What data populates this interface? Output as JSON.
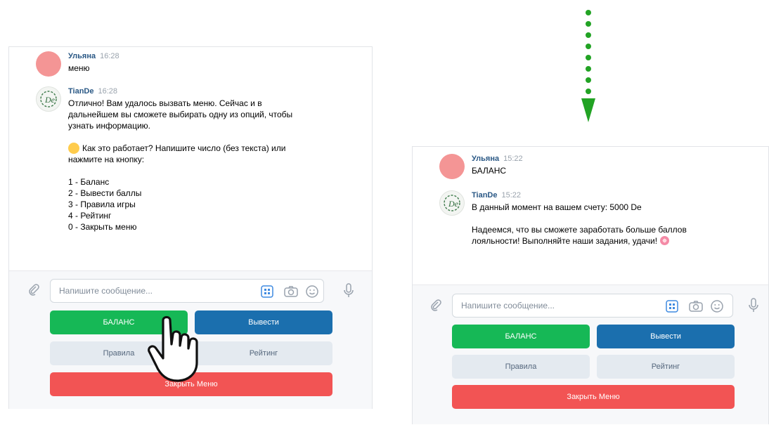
{
  "left": {
    "msg1": {
      "author": "Ульяна",
      "time": "16:28",
      "text": "меню"
    },
    "msg2": {
      "author": "TianDe",
      "time": "16:28",
      "lines": [
        "Отлично! Вам удалось вызвать меню. Сейчас и в",
        "дальнейшем вы сможете выбирать одну из опций, чтобы",
        "узнать информацию.",
        "",
        "Как это работает? Напишите число (без текста) или",
        "нажмите на кнопку:",
        "",
        "1 - Баланс",
        "2 - Вывести баллы",
        "3 - Правила игры",
        "4 - Рейтинг",
        "0 - Закрыть меню"
      ]
    }
  },
  "right": {
    "msg1": {
      "author": "Ульяна",
      "time": "15:22",
      "text": "БАЛАНС"
    },
    "msg2": {
      "author": "TianDe",
      "time": "15:22",
      "lines": [
        "В данный момент на вашем счету: 5000 De",
        "",
        "Надеемся, что вы сможете заработать больше баллов",
        "лояльности! Выполняйте наши задания, удачи!"
      ]
    }
  },
  "composer": {
    "placeholder": "Напишите сообщение..."
  },
  "keyboard": {
    "balance": "БАЛАНС",
    "withdraw": "Вывести",
    "rules": "Правила",
    "rating": "Рейтинг",
    "close": "Закрыть Меню"
  },
  "colors": {
    "green": "#16b856",
    "blue": "#1b6fae",
    "red": "#f25454",
    "grey": "#e4eaf0",
    "arrow": "#22a324",
    "author": "#2a5885"
  },
  "icons": [
    "paperclip-icon",
    "keyboard-icon",
    "camera-icon",
    "smile-icon",
    "microphone-icon",
    "pointing-hand-icon",
    "thinking-emoji-icon",
    "flower-emoji-icon",
    "dotted-arrow-down-icon",
    "tiande-logo-icon"
  ]
}
